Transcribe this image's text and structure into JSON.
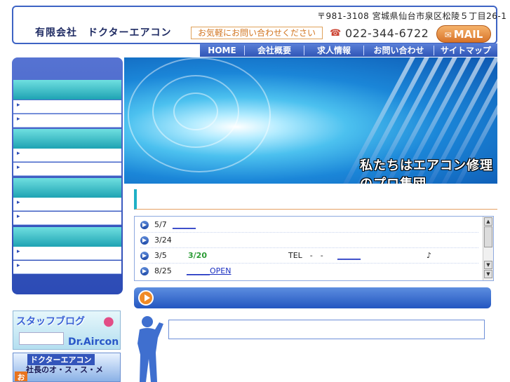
{
  "header": {
    "company_name": "有限会社　ドクターエアコン",
    "address": "〒981-3108 宮城県仙台市泉区松陵５丁目26-1",
    "contact_cta": "お気軽にお問い合わせください",
    "phone_icon": "phone-icon",
    "phone": "022-344-6722",
    "mail_label": "MAIL"
  },
  "nav": {
    "items": [
      {
        "label": "HOME"
      },
      {
        "label": "会社概要"
      },
      {
        "label": "求人情報"
      },
      {
        "label": "お問い合わせ"
      },
      {
        "label": "サイトマップ"
      }
    ]
  },
  "hero": {
    "caption": "私たちはエアコン修理のプロ集団"
  },
  "news": {
    "items": [
      {
        "date": "5/7",
        "link": "______"
      },
      {
        "date": "3/24"
      },
      {
        "date": "3/5",
        "highlight": "3/20",
        "tel": "TEL　-　-",
        "link": "______",
        "note": "♪"
      },
      {
        "date": "8/25",
        "link": "______OPEN"
      }
    ]
  },
  "banners": {
    "blog_title": "スタッフブログ",
    "blog_brand": "Dr.Aircon",
    "promo_line1": "ドクターエアコン",
    "promo_line2": "社長のオ・ス・ス・メ",
    "promo_o": "お"
  },
  "colors": {
    "brand_blue": "#2f56b7",
    "accent_orange": "#d8742a",
    "teal": "#1ea3b3"
  }
}
